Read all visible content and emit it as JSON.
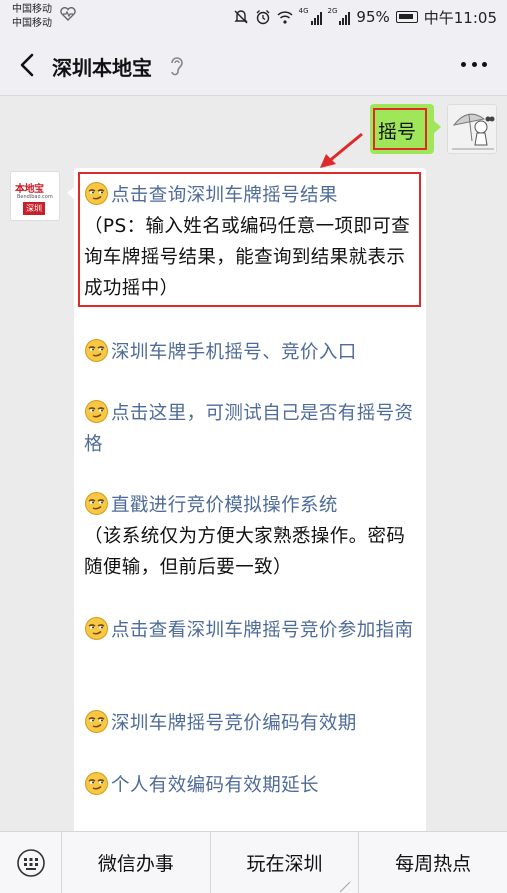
{
  "status_bar": {
    "carrier_1": "中国移动",
    "carrier_2": "中国移动",
    "net_1": "4G",
    "net_2": "2G",
    "battery": "95%",
    "time": "中午11:05"
  },
  "header": {
    "title": "深圳本地宝"
  },
  "user_message": {
    "text": "摇号"
  },
  "bot_avatar": {
    "logo_text": "本地宝",
    "logo_site": "Bendibao.com",
    "logo_city": "深圳"
  },
  "bot_message": {
    "items": [
      {
        "link": "点击查询深圳车牌摇号结果",
        "note": "（PS：输入姓名或编码任意一项即可查询车牌摇号结果，能查询到结果就表示成功摇中）"
      },
      {
        "link": "深圳车牌手机摇号、竞价入口"
      },
      {
        "link": "点击这里，可测试自己是否有摇号资格"
      },
      {
        "link": "直戳进行竞价模拟操作系统",
        "note": "（该系统仅为方便大家熟悉操作。密码随便输，但前后要一致）"
      },
      {
        "link": "点击查看深圳车牌摇号竞价参加指南"
      },
      {
        "link": "深圳车牌摇号竞价编码有效期"
      },
      {
        "link": "个人有效编码有效期延长"
      }
    ]
  },
  "bottom_menu": {
    "items": [
      "微信办事",
      "玩在深圳",
      "每周热点"
    ]
  },
  "colors": {
    "link": "#4e6b9a",
    "user_bubble": "#9fe658",
    "highlight": "#e02a2a"
  }
}
